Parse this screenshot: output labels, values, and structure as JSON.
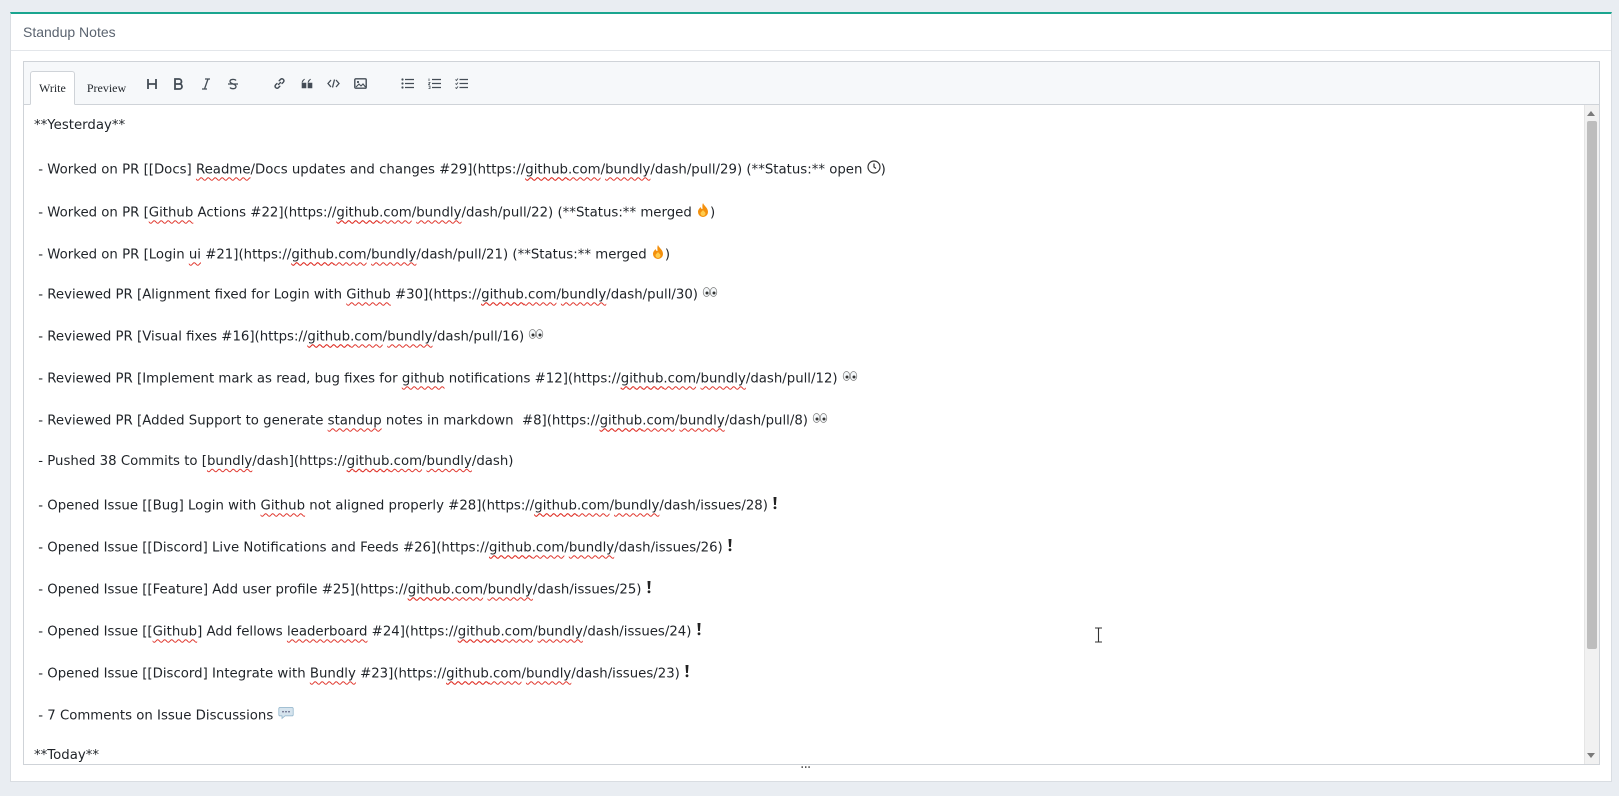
{
  "panel": {
    "title": "Standup Notes"
  },
  "editor": {
    "tabs": [
      {
        "label": "Write",
        "active": true
      },
      {
        "label": "Preview",
        "active": false
      }
    ],
    "toolbar": {
      "icons": [
        "heading-icon",
        "bold-icon",
        "italic-icon",
        "strikethrough-icon",
        "link-icon",
        "quote-icon",
        "code-icon",
        "image-icon",
        "unordered-list-icon",
        "ordered-list-icon",
        "task-list-icon"
      ]
    },
    "lines": [
      "**Yesterday**",
      " - Worked on PR [[Docs] Readme/Docs updates and changes #29](https://github.com/bundly/dash/pull/29) (**Status:** open ",
      " - Worked on PR [Github Actions #22](https://github.com/bundly/dash/pull/22) (**Status:** merged ",
      " - Worked on PR [Login ui #21](https://github.com/bundly/dash/pull/21) (**Status:** merged ",
      " - Reviewed PR [Alignment fixed for Login with Github #30](https://github.com/bundly/dash/pull/30) ",
      " - Reviewed PR [Visual fixes #16](https://github.com/bundly/dash/pull/16) ",
      " - Reviewed PR [Implement mark as read, bug fixes for github notifications #12](https://github.com/bundly/dash/pull/12) ",
      " - Reviewed PR [Added Support to generate standup notes in markdown  #8](https://github.com/bundly/dash/pull/8) ",
      " - Pushed 38 Commits to [bundly/dash](https://github.com/bundly/dash)",
      " - Opened Issue [[Bug] Login with Github not aligned properly #28](https://github.com/bundly/dash/issues/28) ",
      " - Opened Issue [[Discord] Live Notifications and Feeds #26](https://github.com/bundly/dash/issues/26) ",
      " - Opened Issue [[Feature] Add user profile #25](https://github.com/bundly/dash/issues/25) ",
      " - Opened Issue [[Github] Add fellows leaderboard #24](https://github.com/bundly/dash/issues/24) ",
      " - Opened Issue [[Discord] Integrate with Bundly #23](https://github.com/bundly/dash/issues/23) ",
      " - 7 Comments on Issue Discussions ",
      "**Today**"
    ],
    "suffix_icons": [
      "",
      "clock-emoji",
      "fire-emoji",
      "fire-emoji",
      "eyes-emoji",
      "eyes-emoji",
      "eyes-emoji",
      "eyes-emoji",
      "",
      "exclamation-emoji",
      "exclamation-emoji",
      "exclamation-emoji",
      "exclamation-emoji",
      "exclamation-emoji",
      "speech-bubble-emoji",
      ""
    ],
    "closing_paren_after_icon": [
      false,
      true,
      true,
      true,
      false,
      false,
      false,
      false,
      false,
      false,
      false,
      false,
      false,
      false,
      false,
      false
    ]
  },
  "resize_handle": "...",
  "colors": {
    "accent": "#1aa58f",
    "spellcheck": "#e0362d"
  }
}
